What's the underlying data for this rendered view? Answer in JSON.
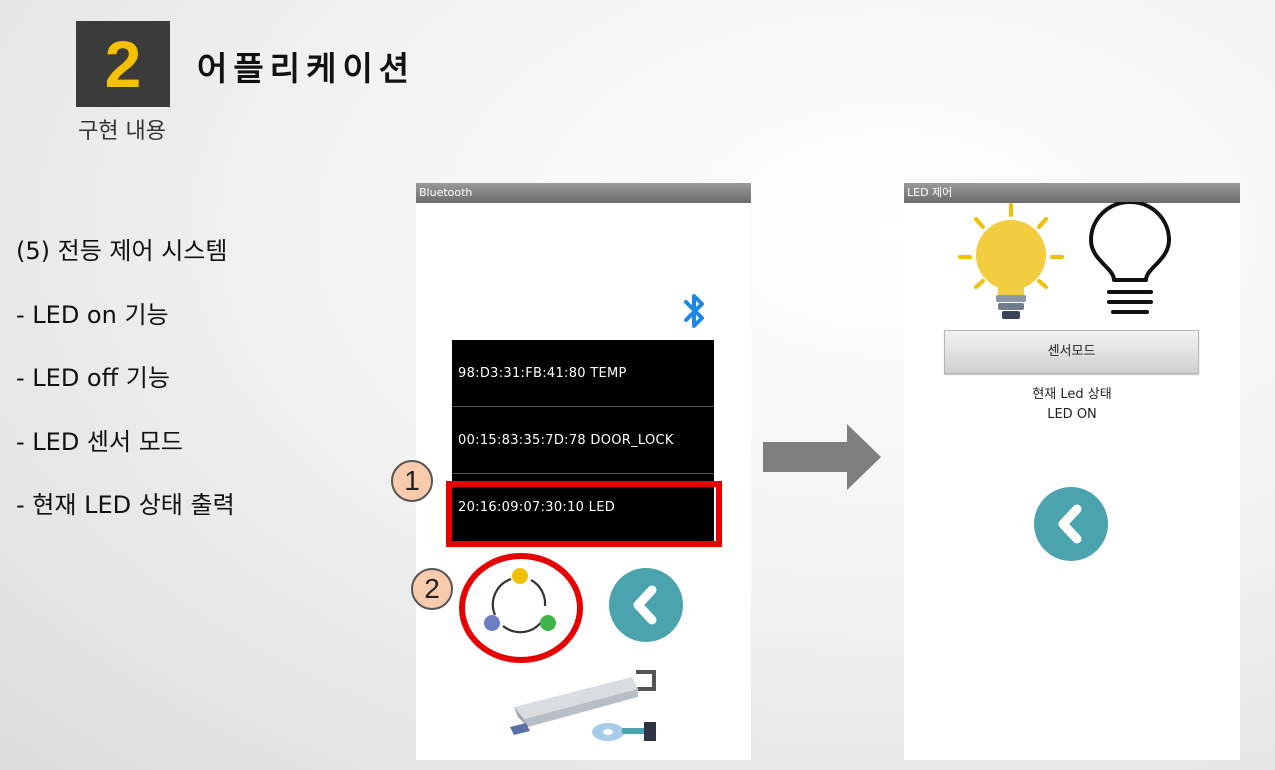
{
  "header": {
    "number": "2",
    "title": "어플리케이션",
    "subtitle": "구현 내용"
  },
  "bullets": [
    "(5) 전등 제어 시스템",
    "- LED on 기능",
    "- LED off 기능",
    "- LED 센서 모드",
    "- 현재 LED 상태 출력"
  ],
  "phone1": {
    "title": "Bluetooth",
    "devices": [
      "98:D3:31:FB:41:80 TEMP",
      "00:15:83:35:7D:78 DOOR_LOCK",
      "20:16:09:07:30:10 LED"
    ],
    "icons": [
      "bluetooth-icon",
      "refresh-scan-icon",
      "back-icon",
      "cctv-camera-icon"
    ]
  },
  "markers": {
    "one": "1",
    "two": "2"
  },
  "phone2": {
    "title": "LED 제어",
    "sensor_button": "센서모드",
    "status_label": "현재 Led 상태",
    "status_value": "LED ON",
    "icons": [
      "bulb-on-icon",
      "bulb-off-icon",
      "back-icon"
    ]
  },
  "colors": {
    "accent_yellow": "#f5c000",
    "highlight_red": "#e60000",
    "teal": "#4aa3ad",
    "bluetooth_blue": "#1e88e5"
  }
}
